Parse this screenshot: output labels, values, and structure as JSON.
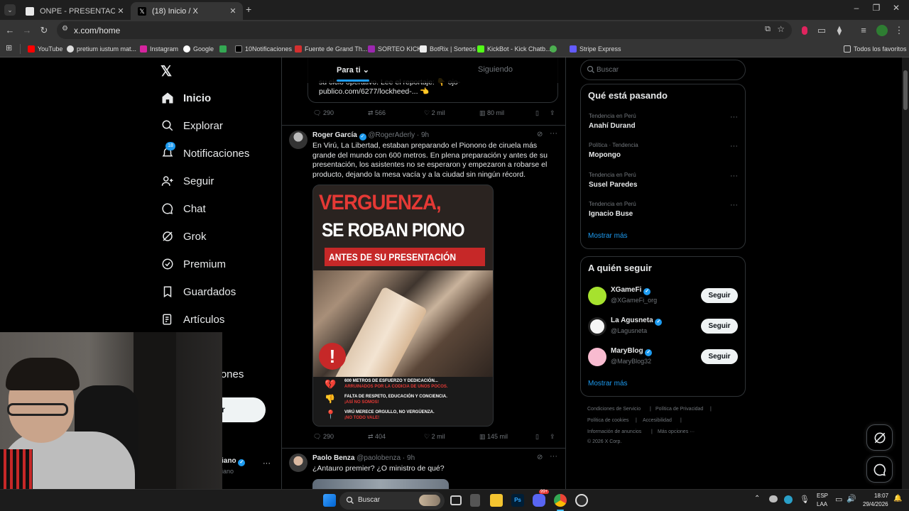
{
  "browser": {
    "tabs": [
      {
        "label": "ONPE - PRESENTACIÓN DE RES"
      },
      {
        "label": "(18) Inicio / X"
      }
    ],
    "url": "x.com/home",
    "bookmarks": [
      "YouTube",
      "pretium iustum mat...",
      "Instagram",
      "Google",
      "10Notificaciones",
      "Fuente de Grand Th...",
      "SORTEO KICK",
      "BotRix | Sorteos",
      "KickBot - Kick Chatb...",
      "Stripe Express"
    ],
    "all_bookmarks": "Todos los favoritos"
  },
  "sidebar": {
    "items": [
      {
        "label": "Inicio",
        "icon": "home-icon"
      },
      {
        "label": "Explorar",
        "icon": "search-icon"
      },
      {
        "label": "Notificaciones",
        "icon": "bell-icon",
        "badge": "18"
      },
      {
        "label": "Seguir",
        "icon": "follow-icon"
      },
      {
        "label": "Chat",
        "icon": "chat-icon"
      },
      {
        "label": "Grok",
        "icon": "grok-icon"
      },
      {
        "label": "Premium",
        "icon": "premium-icon"
      },
      {
        "label": "Guardados",
        "icon": "bookmark-icon"
      },
      {
        "label": "Artículos",
        "icon": "articles-icon"
      }
    ],
    "partial_label": "ciones",
    "partial_button": "r",
    "profile_partial": "iano",
    "profile_partial_handle": "iano"
  },
  "feed": {
    "tabs": [
      "Para ti",
      "Siguiendo"
    ],
    "prev_post": {
      "text_line1": "su ciclo operativo. Lee el reportaje: 👇 ojo-",
      "text_line2": "publico.com/6277/lockheed-... 👈",
      "replies": "290",
      "reposts": "566",
      "likes": "2 mil",
      "views": "80 mil"
    },
    "post": {
      "name": "Roger García",
      "handle": "@RogerAderly",
      "time": "· 9h",
      "text": "En Virú, La Libertad, estaban preparando el Pionono de ciruela más grande del mundo con 600 metros. En plena preparación y antes de su presentación, los asistentes no se esperaron y empezaron a robarse el producto, dejando la mesa vacía y a la ciudad sin ningún récord.",
      "image": {
        "headline1": "VERGUENZA,",
        "headline2": "SE ROBAN PIONO",
        "headline3": "ANTES DE SU PRESENTACIÓN",
        "bullets": [
          {
            "line1": "600 METROS DE ESFUERZO Y DEDICACIÓN...",
            "line2": "ARRUINADOS POR LA CODICIA DE UNOS POCOS."
          },
          {
            "line1": "FALTA DE RESPETO, EDUCACIÓN Y CONCIENCIA.",
            "line2": "¡ASÍ NO SOMOS!"
          },
          {
            "line1": "VIRÚ MERECE ORGULLO, NO VERGÜENZA.",
            "line2": "¡NO TODO VALE!"
          }
        ]
      },
      "replies": "290",
      "reposts": "404",
      "likes": "2 mil",
      "views": "145 mil"
    },
    "next_post": {
      "name": "Paolo Benza",
      "handle": "@paolobenza",
      "time": "· 9h",
      "text": "¿Antauro premier? ¿O ministro de qué?"
    }
  },
  "right": {
    "search_placeholder": "Buscar",
    "trends_title": "Qué está pasando",
    "trends": [
      {
        "category": "Tendencia en Perú",
        "name": "Anahí Durand"
      },
      {
        "category": "Política · Tendencia",
        "name": "Mopongo"
      },
      {
        "category": "Tendencia en Perú",
        "name": "Susel Paredes"
      },
      {
        "category": "Tendencia en Perú",
        "name": "Ignacio Buse"
      }
    ],
    "show_more": "Mostrar más",
    "follow_title": "A quién seguir",
    "follow": [
      {
        "name": "XGameFi",
        "handle": "@XGameFi_org"
      },
      {
        "name": "La Agusneta",
        "handle": "@Lagusneta"
      },
      {
        "name": "MaryBlog",
        "handle": "@MaryBlog32"
      }
    ],
    "follow_button": "Seguir",
    "footer": [
      "Condiciones de Servicio",
      "Política de Privacidad",
      "Política de cookies",
      "Accesibilidad",
      "Información de anuncios",
      "Más opciones ···",
      "© 2026 X Corp."
    ]
  },
  "taskbar": {
    "search": "Buscar",
    "lang1": "ESP",
    "lang2": "LAA",
    "time": "18:07",
    "date": "29/4/2026",
    "badge": "99+"
  },
  "colors": {
    "accent": "#1d9bf0",
    "background": "#000000",
    "border": "#2f3336",
    "muted": "#71767b"
  }
}
